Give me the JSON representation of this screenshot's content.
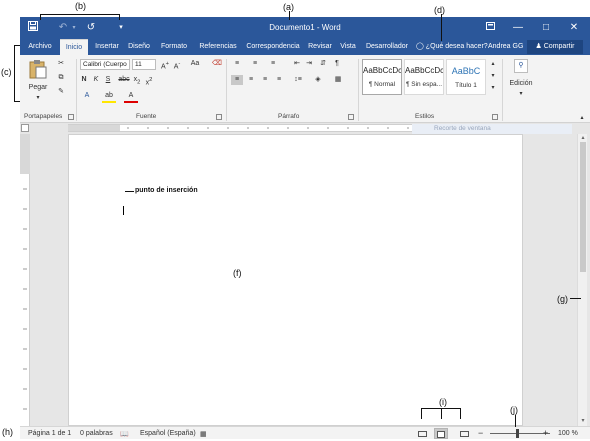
{
  "window_title": "Documento1 - Word",
  "tabs": [
    "Archivo",
    "Inicio",
    "Insertar",
    "Diseño",
    "Formato",
    "Referencias",
    "Correspondencia",
    "Revisar",
    "Vista",
    "Desarrollador"
  ],
  "tell_me": "¿Qué desea hacer?",
  "user_name": "Andrea GG",
  "share_label": "Compartir",
  "clipboard": {
    "paste_label": "Pegar",
    "group_label": "Portapapeles"
  },
  "font": {
    "name": "Calibri (Cuerpo",
    "size": "11",
    "group_label": "Fuente"
  },
  "paragraph": {
    "group_label": "Párrafo"
  },
  "styles": {
    "group_label": "Estilos",
    "items": [
      {
        "preview": "AaBbCcDc",
        "name": "¶ Normal"
      },
      {
        "preview": "AaBbCcDc",
        "name": "¶ Sin espa..."
      },
      {
        "preview": "AaBbC",
        "name": "Título 1"
      }
    ]
  },
  "editing_label": "Edición",
  "tooltip_text": "Recorte de ventana",
  "status": {
    "page": "Página 1 de 1",
    "words": "0 palabras",
    "language": "Español (España)",
    "zoom": "100 %"
  },
  "annotations": {
    "a": "(a)",
    "b": "(b)",
    "c": "(c)",
    "d": "(d)",
    "f": "(f)",
    "g": "(g)",
    "h": "(h)",
    "i": "(i)",
    "j": "(j)",
    "cursor_label": "punto de inserción"
  },
  "colors": {
    "title_bar": "#2b579a",
    "ribbon": "#f3f3f3",
    "canvas": "#e6e6e6"
  }
}
